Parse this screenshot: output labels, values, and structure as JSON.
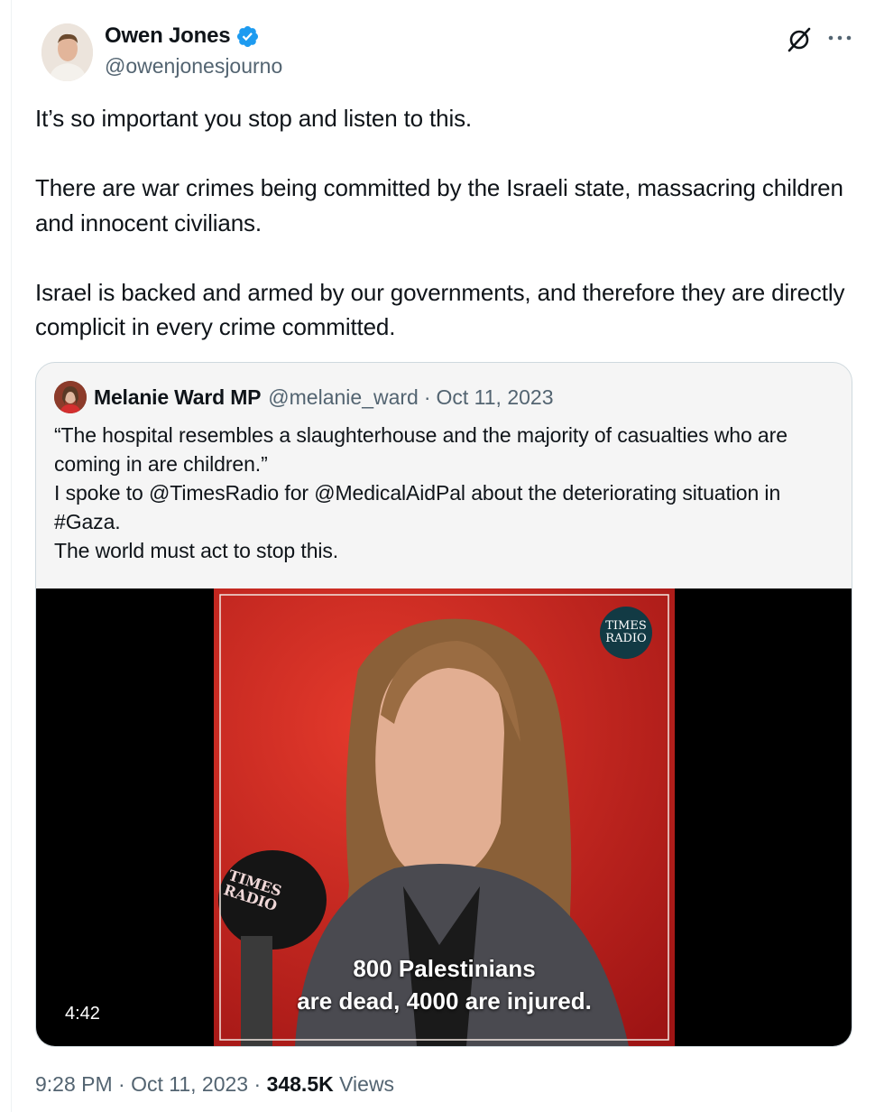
{
  "author": {
    "name": "Owen Jones",
    "handle": "@owenjonesjourno",
    "verified": true
  },
  "icons": {
    "verified": "verified-badge-icon",
    "grok": "grok-icon",
    "more": "more-options-icon"
  },
  "tweet": {
    "text": "It’s so important you stop and listen to this.\n\nThere are war crimes being committed by the Israeli state, massacring children and innocent civilians.\n\nIsrael is backed and armed by our governments, and therefore they are directly complicit in every crime committed."
  },
  "quote": {
    "author_name": "Melanie Ward MP",
    "handle": "@melanie_ward",
    "separator": "·",
    "date": "Oct 11, 2023",
    "text": "“The hospital resembles a slaughterhouse and the majority of casualties who are coming in are children.”\nI spoke to @TimesRadio for @MedicalAidPal about the deteriorating situation in #Gaza.\nThe world must act to stop this.",
    "video": {
      "duration": "4:42",
      "caption_line1": "800 Palestinians",
      "caption_line2": "are dead, 4000 are injured.",
      "logo_line1": "TIMES",
      "logo_line2": "RADIO",
      "mic_text": "TIMES RADIO"
    }
  },
  "footer": {
    "time": "9:28 PM",
    "sep1": "·",
    "date": "Oct 11, 2023",
    "sep2": "·",
    "views_count": "348.5K",
    "views_label": "Views"
  },
  "colors": {
    "text_primary": "#0f1419",
    "text_secondary": "#536471",
    "verified_blue": "#1d9bf0",
    "border": "#cfd9de",
    "video_red": "#c8201f"
  }
}
